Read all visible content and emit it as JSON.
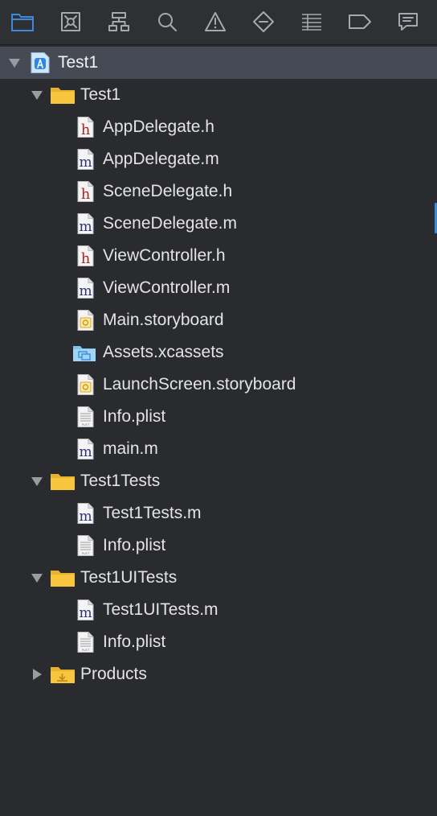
{
  "navigator": {
    "toolbar": {
      "active_index": 0,
      "buttons": [
        {
          "icon": "project-navigator-folder-icon"
        },
        {
          "icon": "source-control-navigator-icon"
        },
        {
          "icon": "symbol-navigator-hierarchy-icon"
        },
        {
          "icon": "find-navigator-search-icon"
        },
        {
          "icon": "issue-navigator-warning-icon"
        },
        {
          "icon": "test-navigator-diamond-icon"
        },
        {
          "icon": "debug-navigator-list-icon"
        },
        {
          "icon": "breakpoint-navigator-tag-icon"
        },
        {
          "icon": "report-navigator-chat-icon"
        }
      ]
    },
    "tree": [
      {
        "label": "Test1",
        "kind": "project",
        "depth": 0,
        "disclosure": "expanded",
        "selected": true
      },
      {
        "label": "Test1",
        "kind": "folder",
        "depth": 1,
        "disclosure": "expanded"
      },
      {
        "label": "AppDelegate.h",
        "kind": "h",
        "depth": 2
      },
      {
        "label": "AppDelegate.m",
        "kind": "m",
        "depth": 2
      },
      {
        "label": "SceneDelegate.h",
        "kind": "h",
        "depth": 2
      },
      {
        "label": "SceneDelegate.m",
        "kind": "m",
        "depth": 2
      },
      {
        "label": "ViewController.h",
        "kind": "h",
        "depth": 2
      },
      {
        "label": "ViewController.m",
        "kind": "m",
        "depth": 2
      },
      {
        "label": "Main.storyboard",
        "kind": "storyboard",
        "depth": 2
      },
      {
        "label": "Assets.xcassets",
        "kind": "assets",
        "depth": 2
      },
      {
        "label": "LaunchScreen.storyboard",
        "kind": "storyboard",
        "depth": 2
      },
      {
        "label": "Info.plist",
        "kind": "plist",
        "depth": 2
      },
      {
        "label": "main.m",
        "kind": "m",
        "depth": 2
      },
      {
        "label": "Test1Tests",
        "kind": "folder",
        "depth": 1,
        "disclosure": "expanded"
      },
      {
        "label": "Test1Tests.m",
        "kind": "m",
        "depth": 2
      },
      {
        "label": "Info.plist",
        "kind": "plist",
        "depth": 2
      },
      {
        "label": "Test1UITests",
        "kind": "folder",
        "depth": 1,
        "disclosure": "expanded"
      },
      {
        "label": "Test1UITests.m",
        "kind": "m",
        "depth": 2
      },
      {
        "label": "Info.plist",
        "kind": "plist",
        "depth": 2
      },
      {
        "label": "Products",
        "kind": "folder-products",
        "depth": 1,
        "disclosure": "collapsed"
      }
    ],
    "colors": {
      "background": "#2a2b2f",
      "toolbar_background": "#2f3034",
      "selection": "#464a55",
      "accent_blue": "#3f89d9",
      "folder_yellow": "#f7c53e",
      "header_letter": "#a02a2a",
      "impl_letter": "#2f2f7a"
    }
  }
}
